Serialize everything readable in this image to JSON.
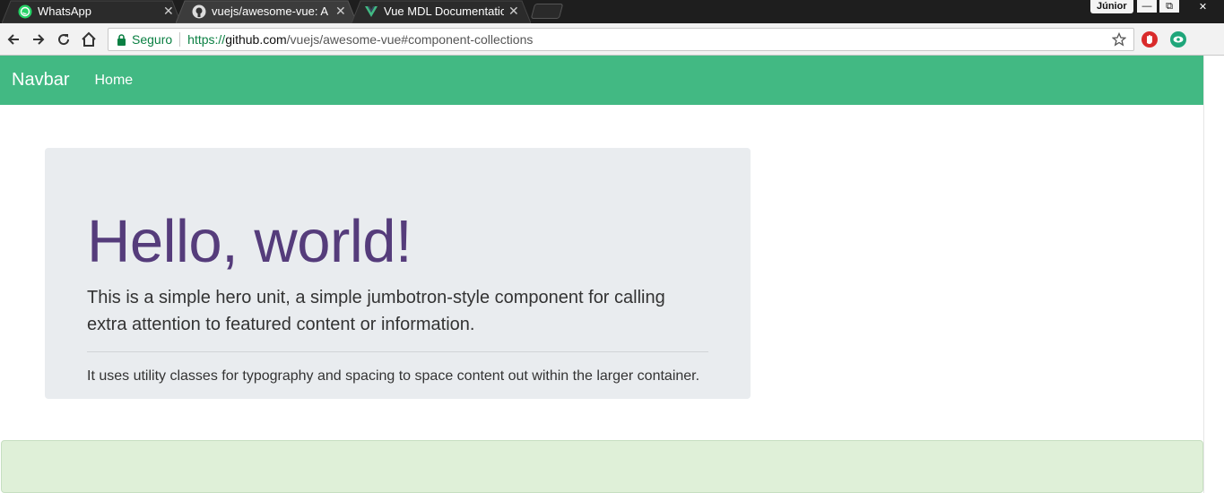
{
  "browser": {
    "tabs": [
      {
        "title": "WhatsApp",
        "icon": "whatsapp-icon",
        "active": false
      },
      {
        "title": "vuejs/awesome-vue: A cu",
        "icon": "github-icon",
        "active": true
      },
      {
        "title": "Vue MDL Documentation",
        "icon": "vue-icon",
        "active": false
      }
    ],
    "profile": "Júnior",
    "window_controls": {
      "minimize": "—",
      "restore": "⧉",
      "close": "✕"
    },
    "toolbar": {
      "back": "←",
      "forward": "→",
      "reload": "↻",
      "home": "⌂",
      "secure_label": "Seguro",
      "url_scheme": "https://",
      "url_host": "github.com",
      "url_path": "/vuejs/awesome-vue#component-collections"
    }
  },
  "page": {
    "navbar": {
      "brand": "Navbar",
      "home": "Home"
    },
    "jumbotron": {
      "heading": "Hello, world!",
      "lead": "This is a simple hero unit, a simple jumbotron-style component for calling extra attention to featured content or information.",
      "text": "It uses utility classes for typography and spacing to space content out within the larger container."
    }
  },
  "colors": {
    "navbar": "#42b983",
    "heading": "#553c7b",
    "jumbotron_bg": "#e9ecef",
    "alert_bg": "#dff0d8"
  }
}
